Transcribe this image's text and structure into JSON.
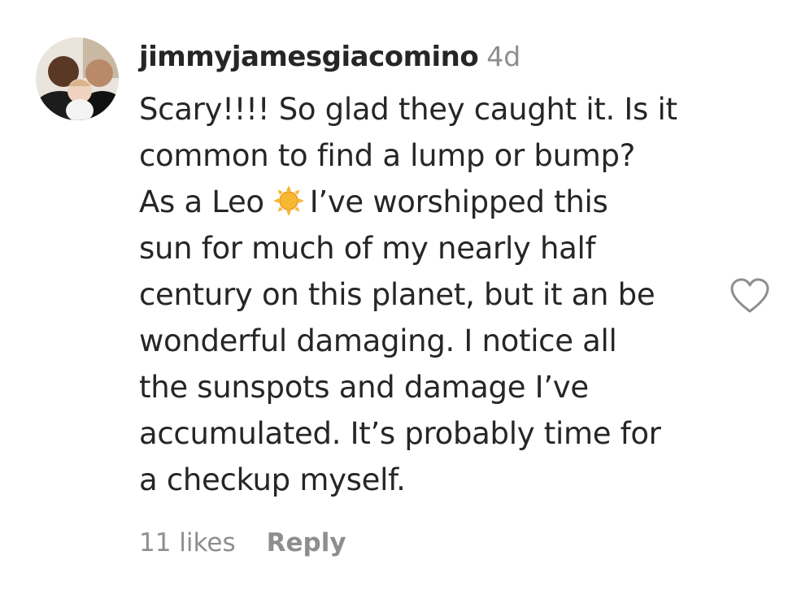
{
  "comment": {
    "username": "jimmyjamesgiacomino",
    "timestamp": "4d",
    "avatar_icon": "avatar-photo",
    "lines": [
      "Scary!!!! So glad they caught it. Is it",
      "common to find a lump or bump?",
      "As a Leo",
      "I’ve worshipped this",
      "sun for much of my nearly half",
      "century on this planet, but it an be",
      "wonderful damaging. I notice all",
      "the sunspots and damage I’ve",
      "accumulated. It’s probably time for",
      "a checkup myself."
    ],
    "emoji": "sun-emoji",
    "likes": "11 likes",
    "reply_label": "Reply",
    "like_icon": "heart-icon"
  },
  "colors": {
    "text": "#262626",
    "secondary": "#8e8e8e",
    "sun": "#f7b733"
  }
}
